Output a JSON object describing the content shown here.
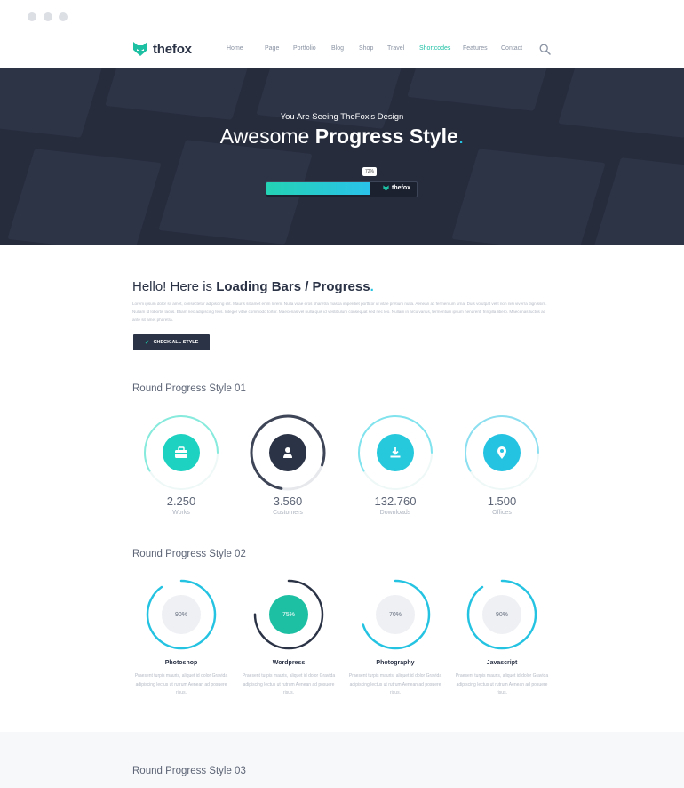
{
  "brand": {
    "name": "thefox",
    "accent": "#25c3e2",
    "green": "#1ec0a4",
    "dark": "#2b3346"
  },
  "nav": {
    "items": [
      {
        "label": "Home"
      },
      {
        "label": "Page"
      },
      {
        "label": "Portfolio"
      },
      {
        "label": "Blog"
      },
      {
        "label": "Shop"
      },
      {
        "label": "Travel"
      },
      {
        "label": "Shortcodes",
        "active": true
      },
      {
        "label": "Features"
      },
      {
        "label": "Contact"
      }
    ],
    "search_icon": "search-icon"
  },
  "hero": {
    "subtitle": "You Are Seeing TheFox's Design",
    "title_light": "Awesome",
    "title_bold": "Progress Style",
    "title_dot": ".",
    "progress": {
      "percent": 72,
      "tooltip": "72%",
      "logo_text": "thefox"
    }
  },
  "intro": {
    "title_light": "Hello! Here is",
    "title_bold": "Loading Bars / Progress",
    "title_dot": ".",
    "body": "Lorem ipsum dolor sit amet, consectetur adipiscing elit. Mauris sit amet enim lorem. Nulla vitae eros pharetra massa imperdiet porttitor id vitae pretium nulla. Aenean ac fermentum urna. Duis volutpat velit non nisi viverra dignissim. Nullam id lobortis lacus. Etiam nec adipiscing felis. Integer vitae commodo tortor. Maecenas vel nulla quis id vestibulum consequat sed nec leo. Nullam in arcu varius, fermentum ipsum hendrerit, fringilla libero. Maecenas luctus ac ante sit amet pharetra.",
    "button_label": "CHECK ALL STYLE"
  },
  "style01": {
    "title": "Round Progress Style 01",
    "items": [
      {
        "value": "2.250",
        "label": "Works",
        "icon": "briefcase-icon",
        "color": "#1ed2c1",
        "ring": "#7ae8d8"
      },
      {
        "value": "3.560",
        "label": "Customers",
        "icon": "user-icon",
        "color": "#2b3346",
        "ring": "#2b3346"
      },
      {
        "value": "132.760",
        "label": "Downloads",
        "icon": "download-icon",
        "color": "#26c9dc",
        "ring": "#73e0ec"
      },
      {
        "value": "1.500",
        "label": "Offices",
        "icon": "location-pin-icon",
        "color": "#25c3e2",
        "ring": "#80dbee"
      }
    ]
  },
  "style02": {
    "title": "Round Progress Style 02",
    "items": [
      {
        "title": "Photoshop",
        "percent": 90,
        "label": "90%",
        "ring": "#25c3e2",
        "fill": "#eef0f3",
        "text": "Praesent turpis mauris, aliquet id dolor Gravida adipiscing lectus ut rutrum Aenean ad posuere risus."
      },
      {
        "title": "Wordpress",
        "percent": 75,
        "label": "75%",
        "ring": "#2b3346",
        "fill": "#1ec0a4",
        "text": "Praesent turpis mauris, aliquet id dolor Gravida adipiscing lectus ut rutrum Aenean ad posuere risus."
      },
      {
        "title": "Photography",
        "percent": 70,
        "label": "70%",
        "ring": "#25c3e2",
        "fill": "#eef0f3",
        "text": "Praesent turpis mauris, aliquet id dolor Gravida adipiscing lectus ut rutrum Aenean ad posuere risus."
      },
      {
        "title": "Javascript",
        "percent": 90,
        "label": "90%",
        "ring": "#25c3e2",
        "fill": "#eef0f3",
        "text": "Praesent turpis mauris, aliquet id dolor Gravida adipiscing lectus ut rutrum Aenean ad posuere risus."
      }
    ]
  },
  "style03": {
    "title": "Round Progress Style 03"
  }
}
